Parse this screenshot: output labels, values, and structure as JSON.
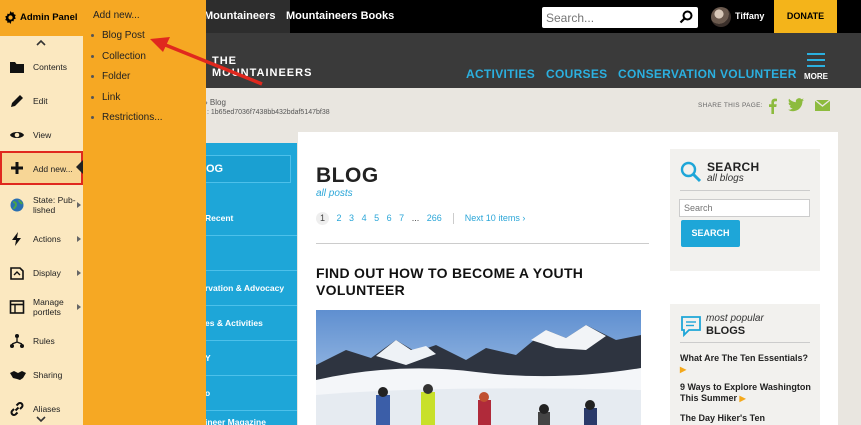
{
  "topbar": {
    "tabs": [
      "Mountaineers",
      "Mountaineers Books"
    ],
    "search_placeholder": "Search...",
    "username": "Tiffany",
    "donate": "DONATE"
  },
  "header": {
    "logo_line1": "THE",
    "logo_line2": "MOUNTAINEERS",
    "nav": [
      "ACTIVITIES",
      "COURSES",
      "CONSERVATION",
      "VOLUNTEER"
    ],
    "more": "MORE"
  },
  "breadcrumb": {
    "crumb": "›  Blog",
    "uid": ": 1b65ed7036f7438bb432bdaf5147bf38",
    "share_label": "SHARE THIS PAGE:"
  },
  "bluemenu": {
    "header": "OG",
    "items": [
      "Recent",
      "",
      "rvation & Advocacy",
      "es & Activities",
      "Y",
      "o",
      "ineer Magazine"
    ]
  },
  "main": {
    "title": "BLOG",
    "subtitle": "all posts",
    "pages": [
      "1",
      "2",
      "3",
      "4",
      "5",
      "6",
      "7",
      "...",
      "266"
    ],
    "next": "Next 10 items ›",
    "headline": "FIND OUT HOW TO BECOME A YOUTH VOLUNTEER"
  },
  "search_card": {
    "title": "SEARCH",
    "subtitle": "all blogs",
    "placeholder": "Search",
    "button": "SEARCH"
  },
  "popular": {
    "subtitle": "most popular",
    "title": "BLOGS",
    "items": [
      "What Are The Ten Essentials?",
      "9 Ways to Explore Washington This Summer",
      "The Day Hiker's Ten"
    ]
  },
  "admin": {
    "title": "Admin Panel",
    "items": [
      {
        "label": "Contents",
        "icon": "folder-icon"
      },
      {
        "label": "Edit",
        "icon": "pencil-icon"
      },
      {
        "label": "View",
        "icon": "eye-icon"
      },
      {
        "label": "Add new...",
        "icon": "plus-icon"
      },
      {
        "label": "State: Pub-\nlished",
        "icon": "globe-icon"
      },
      {
        "label": "Actions",
        "icon": "lightning-icon"
      },
      {
        "label": "Display",
        "icon": "display-icon"
      },
      {
        "label": "Manage\nportlets",
        "icon": "portlets-icon"
      },
      {
        "label": "Rules",
        "icon": "rules-icon"
      },
      {
        "label": "Sharing",
        "icon": "handshake-icon"
      },
      {
        "label": "Aliases",
        "icon": "link-icon"
      }
    ]
  },
  "addnew": {
    "header": "Add new...",
    "options": [
      "Blog Post",
      "Collection",
      "Folder",
      "Link",
      "Restrictions..."
    ]
  },
  "colors": {
    "accent_blue": "#1ea6d8",
    "admin_orange": "#f6a823",
    "donate_yellow": "#f4b41a",
    "highlight_red": "#e0281e"
  }
}
